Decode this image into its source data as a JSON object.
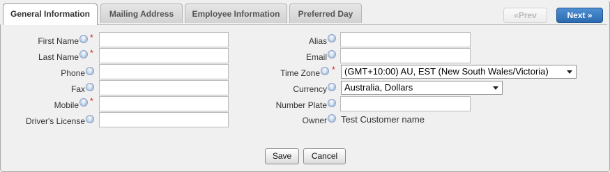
{
  "tabs": [
    {
      "label": "General Information",
      "active": true
    },
    {
      "label": "Mailing Address",
      "active": false
    },
    {
      "label": "Employee Information",
      "active": false
    },
    {
      "label": "Preferred Day",
      "active": false
    }
  ],
  "nav": {
    "prev_label": "«Prev",
    "next_label": "Next »"
  },
  "left_fields": [
    {
      "label": "First Name",
      "required": true,
      "value": ""
    },
    {
      "label": "Last Name",
      "required": true,
      "value": ""
    },
    {
      "label": "Phone",
      "required": false,
      "value": ""
    },
    {
      "label": "Fax",
      "required": false,
      "value": ""
    },
    {
      "label": "Mobile",
      "required": true,
      "value": ""
    },
    {
      "label": "Driver's License",
      "required": false,
      "value": ""
    }
  ],
  "right_fields": {
    "alias": {
      "label": "Alias",
      "value": ""
    },
    "email": {
      "label": "Email",
      "value": ""
    },
    "time_zone": {
      "label": "Time Zone",
      "required": true,
      "selected": "(GMT+10:00) AU, EST (New South Wales/Victoria)"
    },
    "currency": {
      "label": "Currency",
      "selected": "Australia, Dollars"
    },
    "number_plate": {
      "label": "Number Plate",
      "value": ""
    },
    "owner": {
      "label": "Owner",
      "value": "Test Customer name"
    }
  },
  "required_marker": "*",
  "help_glyph": "?",
  "buttons": {
    "save": "Save",
    "cancel": "Cancel"
  },
  "colors": {
    "accent": "#2c6bb1",
    "required": "#d01010",
    "background": "#f0f0f0"
  }
}
